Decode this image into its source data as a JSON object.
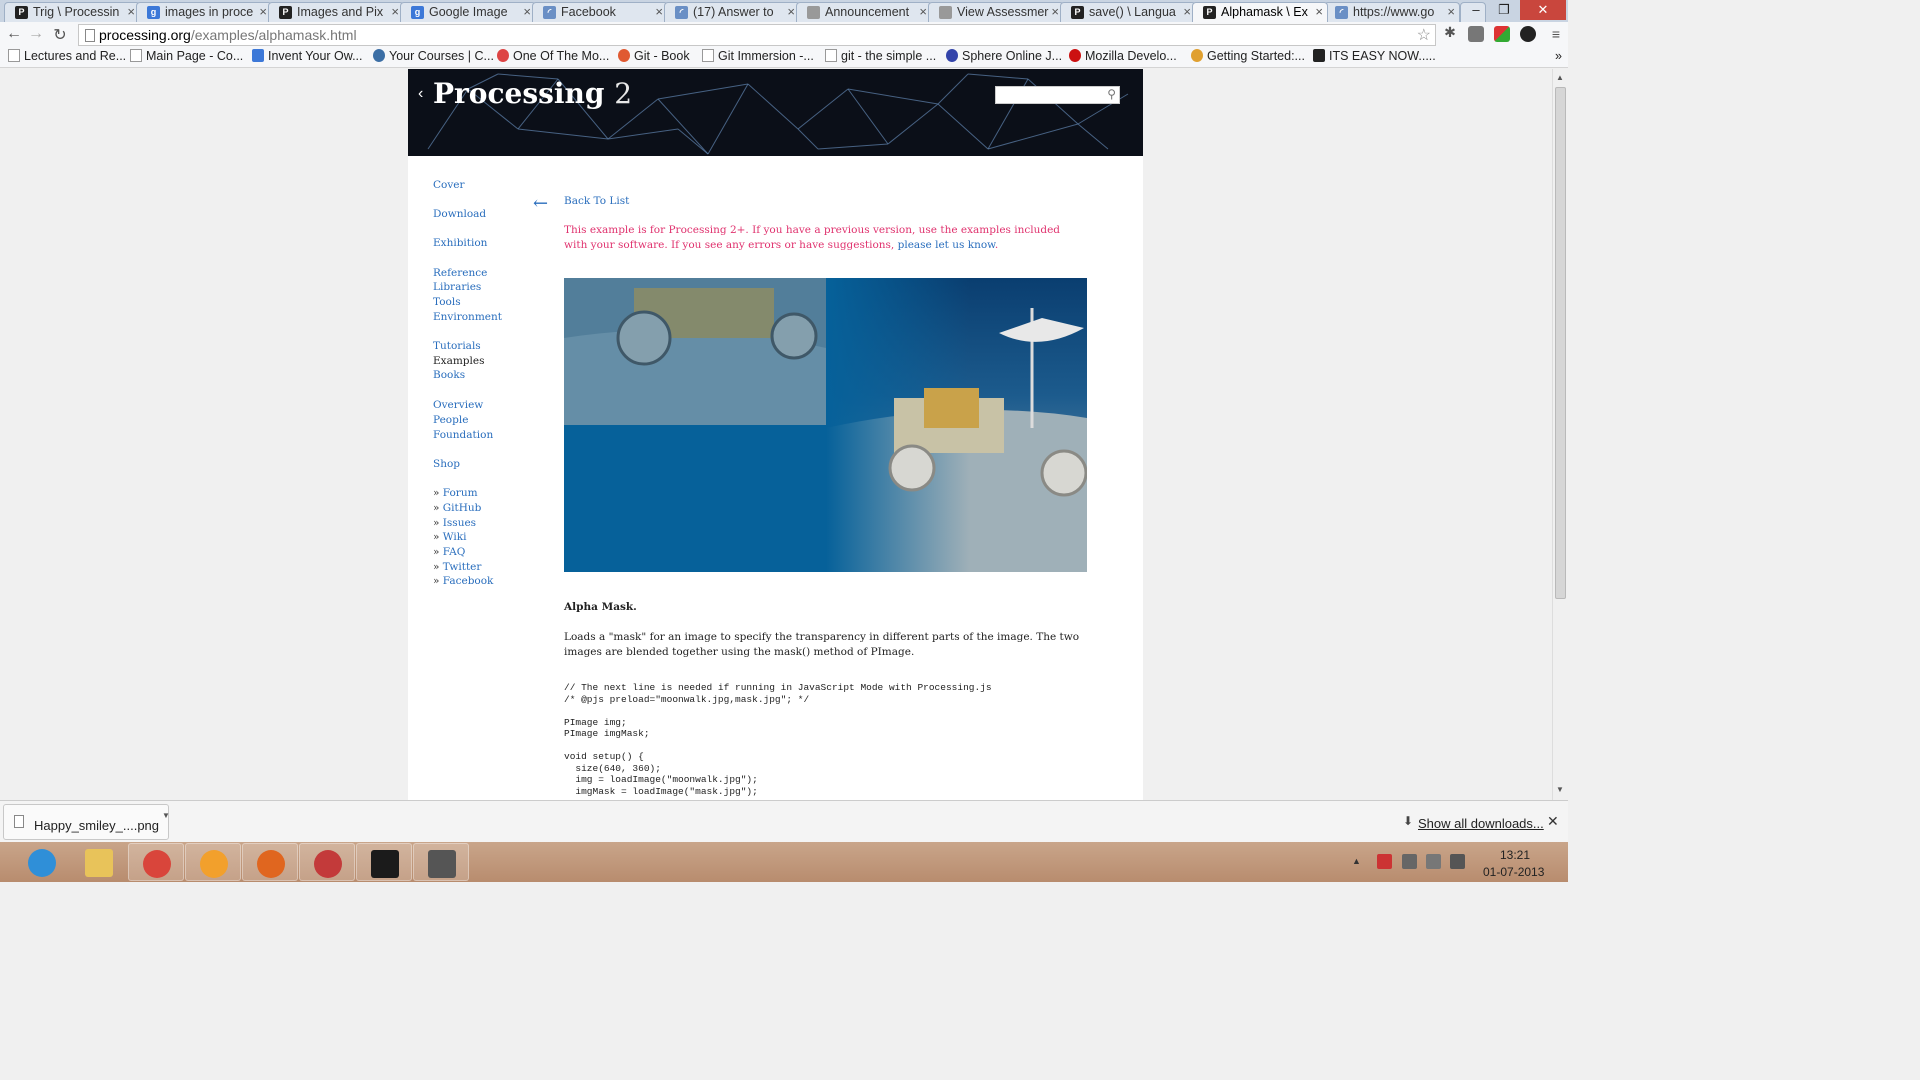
{
  "browser": {
    "tabs": [
      {
        "title": "Trig \\ Processin",
        "icon": "processing-icon",
        "color": "#222222",
        "glyph": "P"
      },
      {
        "title": "images in proce",
        "icon": "google-icon",
        "color": "#3c78d8",
        "glyph": "g"
      },
      {
        "title": "Images and Pix",
        "icon": "processing-icon",
        "color": "#222222",
        "glyph": "P"
      },
      {
        "title": "Google Image",
        "icon": "google-icon",
        "color": "#3c78d8",
        "glyph": "g"
      },
      {
        "title": "Facebook",
        "icon": "loading-icon",
        "color": "#6a8fc5",
        "glyph": "◜"
      },
      {
        "title": "(17) Answer to",
        "icon": "loading-icon",
        "color": "#6a8fc5",
        "glyph": "◜"
      },
      {
        "title": "Announcement",
        "icon": "page-icon",
        "color": "#999999",
        "glyph": ""
      },
      {
        "title": "View Assessmer",
        "icon": "page-icon",
        "color": "#999999",
        "glyph": ""
      },
      {
        "title": "save() \\ Langua",
        "icon": "processing-icon",
        "color": "#222222",
        "glyph": "P"
      },
      {
        "title": "Alphamask \\ Ex",
        "icon": "processing-icon",
        "color": "#222222",
        "glyph": "P"
      },
      {
        "title": "https://www.go",
        "icon": "loading-icon",
        "color": "#6a8fc5",
        "glyph": "◜"
      }
    ],
    "active_tab": 9,
    "url_host": "processing.org",
    "url_path": "/examples/alphamask.html",
    "window_controls": {
      "minimize": "–",
      "maximize": "❐",
      "close": "✕"
    },
    "bookmarks": [
      {
        "label": "Lectures and Re...",
        "icon": "page-icon"
      },
      {
        "label": "Main Page - Co...",
        "icon": "page-icon"
      },
      {
        "label": "Invent Your Ow...",
        "icon": "google-icon"
      },
      {
        "label": "Your Courses | C...",
        "icon": "courses-icon"
      },
      {
        "label": "One Of The Mo...",
        "icon": "gmail-icon"
      },
      {
        "label": "Git - Book",
        "icon": "git-icon"
      },
      {
        "label": "Git Immersion -...",
        "icon": "page-icon"
      },
      {
        "label": "git - the simple ...",
        "icon": "page-icon"
      },
      {
        "label": "Sphere Online J...",
        "icon": "sphere-icon"
      },
      {
        "label": "Mozilla Develo...",
        "icon": "mozilla-icon"
      },
      {
        "label": "Getting Started:...",
        "icon": "chrome-icon"
      },
      {
        "label": "ITS EASY NOW.....",
        "icon": "its-icon"
      }
    ],
    "bookmarks_overflow": "»"
  },
  "site": {
    "logo_main": "Processing",
    "logo_version": "2",
    "sidebar": [
      {
        "label": "Cover"
      },
      {
        "label": "Download"
      },
      {
        "label": "Exhibition"
      },
      {
        "label": "Reference"
      },
      {
        "label": "Libraries"
      },
      {
        "label": "Tools"
      },
      {
        "label": "Environment"
      },
      {
        "label": "Tutorials"
      },
      {
        "label": "Examples",
        "current": true
      },
      {
        "label": "Books"
      },
      {
        "label": "Overview"
      },
      {
        "label": "People"
      },
      {
        "label": "Foundation"
      },
      {
        "label": "Shop"
      },
      {
        "label": "Forum",
        "external": true
      },
      {
        "label": "GitHub",
        "external": true
      },
      {
        "label": "Issues",
        "external": true
      },
      {
        "label": "Wiki",
        "external": true
      },
      {
        "label": "FAQ",
        "external": true
      },
      {
        "label": "Twitter",
        "external": true
      },
      {
        "label": "Facebook",
        "external": true
      }
    ],
    "back_to_list": "Back To List",
    "notice_text": "This example is for Processing 2+. If you have a previous version, use the examples included with your software. If you see any errors or have suggestions, ",
    "notice_link": "please let us know",
    "notice_end": ".",
    "example_title": "Alpha Mask.",
    "example_description": "Loads a \"mask\" for an image to specify the transparency in different parts of the image. The two images are blended together using the mask() method of PImage.",
    "code": "// The next line is needed if running in JavaScript Mode with Processing.js\n/* @pjs preload=\"moonwalk.jpg,mask.jpg\"; */\n\nPImage img;\nPImage imgMask;\n\nvoid setup() {\n  size(640, 360);\n  img = loadImage(\"moonwalk.jpg\");\n  imgMask = loadImage(\"mask.jpg\");"
  },
  "downloads": {
    "item_name": "Happy_smiley_....png",
    "show_all": "Show all downloads..."
  },
  "taskbar": {
    "apps": [
      {
        "icon": "internet-explorer-icon",
        "color": "#2f8fd8"
      },
      {
        "icon": "file-explorer-icon",
        "color": "#e8c35a"
      },
      {
        "icon": "chrome-icon",
        "color": "#d9453b"
      },
      {
        "icon": "outlook-icon",
        "color": "#f2a02c"
      },
      {
        "icon": "firefox-icon",
        "color": "#e0661f"
      },
      {
        "icon": "processing-app-icon",
        "color": "#c33a3a"
      },
      {
        "icon": "processing-icon",
        "color": "#1b1b1b"
      },
      {
        "icon": "sketch-window-icon",
        "color": "#555555"
      }
    ],
    "time": "13:21",
    "date": "01-07-2013"
  }
}
